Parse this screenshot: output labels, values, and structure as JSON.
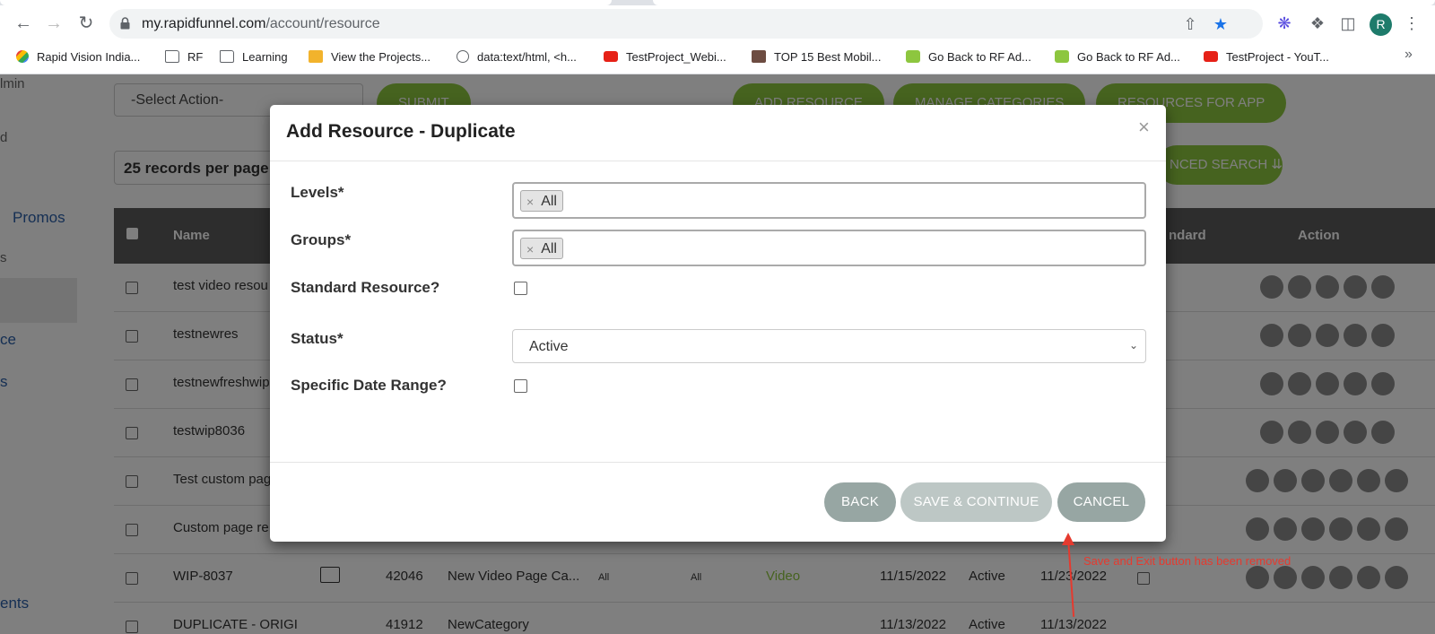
{
  "browser": {
    "url_host": "my.rapidfunnel.com",
    "url_path": "/account/resource",
    "avatar_letter": "R",
    "bookmarks": [
      {
        "label": "Rapid Vision India...",
        "icon": "pinwheel-icon"
      },
      {
        "label": "RF",
        "icon": "folder-icon"
      },
      {
        "label": "Learning",
        "icon": "folder-icon"
      },
      {
        "label": "View the Projects...",
        "icon": "box-icon"
      },
      {
        "label": "data:text/html, <h...",
        "icon": "globe-icon"
      },
      {
        "label": "TestProject_Webi...",
        "icon": "youtube-icon"
      },
      {
        "label": "TOP 15 Best Mobil...",
        "icon": "image-icon"
      },
      {
        "label": "Go Back to RF Ad...",
        "icon": "rf-icon"
      },
      {
        "label": "Go Back to RF Ad...",
        "icon": "rf-icon"
      },
      {
        "label": "TestProject - YouT...",
        "icon": "youtube-icon"
      }
    ]
  },
  "page": {
    "sidebar": [
      "lmin",
      "d",
      "Promos",
      "s",
      "ce",
      "s",
      "ents"
    ],
    "select_action": "-Select Action-",
    "submit": "SUBMIT",
    "add_resource": "ADD RESOURCE",
    "manage_categories": "MANAGE CATEGORIES",
    "resources_for_app": "RESOURCES FOR APP",
    "records_per_page": "25 records per page",
    "advanced_search": "NCED SEARCH",
    "columns": {
      "name": "Name",
      "standard": "ndard",
      "action": "Action"
    },
    "rows": [
      {
        "name": "test video resou"
      },
      {
        "name": "testnewres"
      },
      {
        "name": "testnewfreshwip"
      },
      {
        "name": "testwip8036"
      },
      {
        "name": "Test custom pag"
      },
      {
        "name": "Custom page re"
      },
      {
        "name": "WIP-8037",
        "id": "42046",
        "category": "New Video Page Ca...",
        "levels": "All",
        "groups": "All",
        "type": "Video",
        "date": "11/15/2022",
        "status": "Active",
        "date2": "11/23/2022"
      },
      {
        "name": "DUPLICATE - ORIGI",
        "id": "41912",
        "category": "NewCategory",
        "date": "11/13/2022",
        "status": "Active",
        "date2": "11/13/2022"
      }
    ]
  },
  "modal": {
    "title": "Add Resource - Duplicate",
    "close": "×",
    "levels_label": "Levels*",
    "levels_tag": "All",
    "groups_label": "Groups*",
    "groups_tag": "All",
    "tag_remove": "×",
    "standard_label": "Standard Resource?",
    "status_label": "Status*",
    "status_value": "Active",
    "date_range_label": "Specific Date Range?",
    "back": "BACK",
    "save_continue": "SAVE & CONTINUE",
    "cancel": "CANCEL",
    "colors": {
      "button_dark": "#97a6a3",
      "button_light": "#bdc7c5",
      "annotation": "#e53a2f"
    }
  },
  "annotation": {
    "text": "Save and Exit button has been removed"
  }
}
